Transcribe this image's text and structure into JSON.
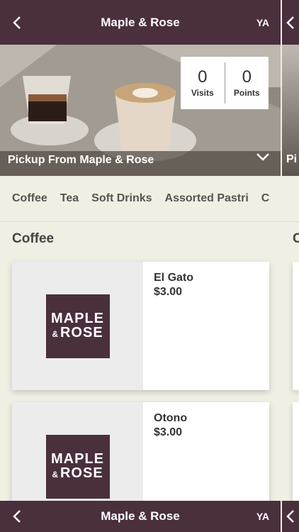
{
  "header": {
    "title": "Maple & Rose",
    "initials": "YA"
  },
  "hero": {
    "pickup_text": "Pickup From Maple & Rose",
    "peek_text": "Pi",
    "stats": [
      {
        "value": "0",
        "label": "Visits"
      },
      {
        "value": "0",
        "label": "Points"
      }
    ]
  },
  "tabs": [
    "Coffee",
    "Tea",
    "Soft Drinks",
    "Assorted Pastri",
    "C"
  ],
  "section": {
    "title": "Coffee",
    "peek": "C"
  },
  "products": [
    {
      "name": "El Gato",
      "price": "$3.00",
      "logo_line1": "MAPLE",
      "logo_amp": "&",
      "logo_line2": "ROSE"
    },
    {
      "name": "Otono",
      "price": "$3.00",
      "logo_line1": "MAPLE",
      "logo_amp": "&",
      "logo_line2": "ROSE"
    }
  ],
  "footer": {
    "title": "Maple & Rose",
    "initials": "YA"
  },
  "colors": {
    "brand": "#4a2f3d",
    "background": "#efefe3"
  }
}
